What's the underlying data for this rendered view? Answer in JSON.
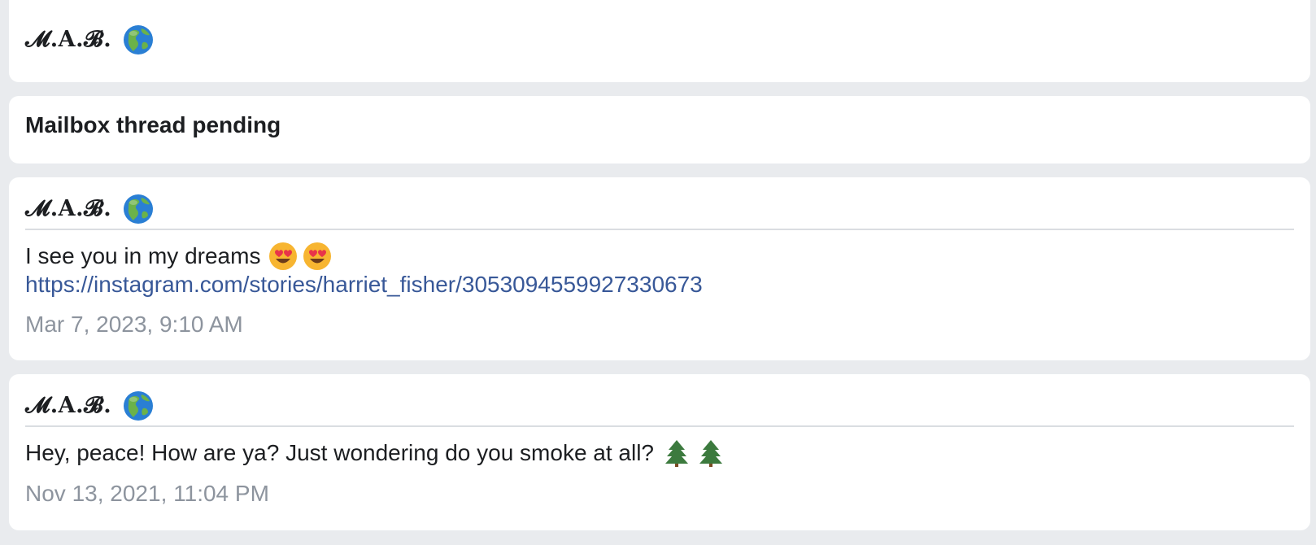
{
  "header": {
    "sender_name": "𝓜.𝐀.𝓑.",
    "sender_icon": "globe-americas-icon"
  },
  "status": {
    "title": "Mailbox thread pending"
  },
  "messages": [
    {
      "sender_name": "𝓜.𝐀.𝓑.",
      "sender_icon": "globe-americas-icon",
      "text": "I see you in my dreams",
      "emojis": [
        "heart-eyes-emoji",
        "heart-eyes-emoji"
      ],
      "link": "https://instagram.com/stories/harriet_fisher/3053094559927330673",
      "timestamp": "Mar 7, 2023, 9:10 AM"
    },
    {
      "sender_name": "𝓜.𝐀.𝓑.",
      "sender_icon": "globe-americas-icon",
      "text": "Hey, peace! How are ya? Just wondering do you smoke at all?",
      "emojis": [
        "evergreen-tree-emoji",
        "evergreen-tree-emoji"
      ],
      "timestamp": "Nov 13, 2021, 11:04 PM"
    }
  ],
  "colors": {
    "background": "#e9ebee",
    "card": "#ffffff",
    "link": "#385898",
    "timestamp": "#8d949e",
    "divider": "#dadde1"
  }
}
